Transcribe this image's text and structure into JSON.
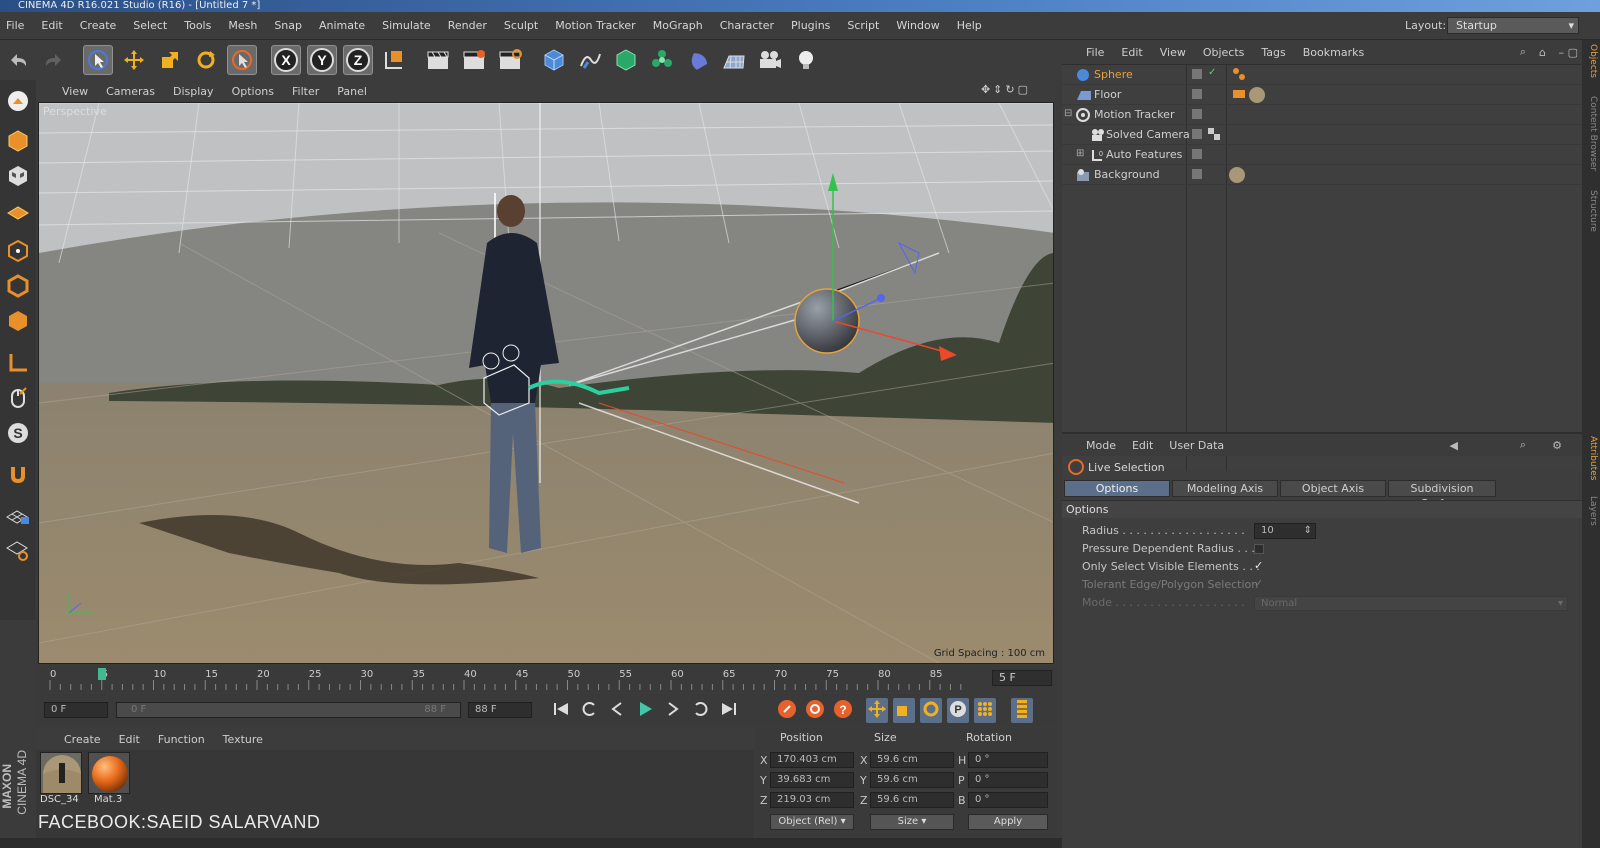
{
  "window": {
    "title": "CINEMA 4D R16.021 Studio (R16) - [Untitled 7 *]"
  },
  "menubar": {
    "items": [
      "File",
      "Edit",
      "Create",
      "Select",
      "Tools",
      "Mesh",
      "Snap",
      "Animate",
      "Simulate",
      "Render",
      "Sculpt",
      "Motion Tracker",
      "MoGraph",
      "Character",
      "Plugins",
      "Script",
      "Window",
      "Help"
    ],
    "layout_label": "Layout:",
    "layout_value": "Startup"
  },
  "toolbar": {
    "axis_x": "X",
    "axis_y": "Y",
    "axis_z": "Z"
  },
  "viewport": {
    "menu": [
      "View",
      "Cameras",
      "Display",
      "Options",
      "Filter",
      "Panel"
    ],
    "label": "Perspective",
    "grid_spacing": "Grid Spacing : 100 cm"
  },
  "timeline": {
    "ticks": [
      "0",
      "5",
      "10",
      "15",
      "20",
      "25",
      "30",
      "35",
      "40",
      "45",
      "50",
      "55",
      "60",
      "65",
      "70",
      "75",
      "80",
      "85"
    ],
    "end_frame": "5 F",
    "start_field": "0 F",
    "range_start": "0 F",
    "range_end": "88 F",
    "end_field": "88 F"
  },
  "material_manager": {
    "menu": [
      "Create",
      "Edit",
      "Function",
      "Texture"
    ],
    "materials": [
      {
        "name": "DSC_34",
        "kind": "photo"
      },
      {
        "name": "Mat.3",
        "kind": "orange-sphere"
      }
    ]
  },
  "coordinates": {
    "headers": {
      "position": "Position",
      "size": "Size",
      "rotation": "Rotation"
    },
    "rows": [
      {
        "axis": "X",
        "pos": "170.403 cm",
        "size_axis": "X",
        "size": "59.6 cm",
        "rot_axis": "H",
        "rot": "0 °"
      },
      {
        "axis": "Y",
        "pos": "39.683 cm",
        "size_axis": "Y",
        "size": "59.6 cm",
        "rot_axis": "P",
        "rot": "0 °"
      },
      {
        "axis": "Z",
        "pos": "219.03 cm",
        "size_axis": "Z",
        "size": "59.6 cm",
        "rot_axis": "B",
        "rot": "0 °"
      }
    ],
    "mode_select": "Object (Rel)",
    "size_select": "Size",
    "apply": "Apply"
  },
  "object_manager": {
    "menu": [
      "File",
      "Edit",
      "View",
      "Objects",
      "Tags",
      "Bookmarks"
    ],
    "objects": [
      {
        "name": "Sphere",
        "selected": true
      },
      {
        "name": "Floor",
        "selected": false
      },
      {
        "name": "Motion Tracker",
        "selected": false
      },
      {
        "name": "Solved Camera",
        "selected": false
      },
      {
        "name": "Auto Features",
        "selected": false
      },
      {
        "name": "Background",
        "selected": false
      }
    ]
  },
  "attribute_manager": {
    "menu": [
      "Mode",
      "Edit",
      "User Data"
    ],
    "mode_title": "Live Selection",
    "tabs": [
      "Options",
      "Modeling Axis",
      "Object Axis",
      "Subdivision Surface"
    ],
    "section": "Options",
    "fields": {
      "radius_label": "Radius . . . . . . . . . . . . . . . . . .",
      "radius_value": "10",
      "pressure_label": "Pressure Dependent Radius . . .",
      "visible_label": "Only Select Visible Elements . . .",
      "tolerant_label": "Tolerant Edge/Polygon Selection",
      "mode_label": "Mode . . . . . . . . . . . . . . . . . . .",
      "mode_value": "Normal"
    }
  },
  "side_tabs": [
    "Objects",
    "Content Browser",
    "Structure",
    "Attributes",
    "Layers"
  ],
  "branding": {
    "maxon": "MAXON",
    "cinema": "CINEMA 4D"
  },
  "watermark": "FACEBOOK:SAEID SALARVAND",
  "colors": {
    "accent_blue": "#5b6f8b",
    "selected_object": "#e8a23a",
    "axis_x": "#e84a2a",
    "axis_y": "#35c24a",
    "axis_z": "#5566ee"
  }
}
